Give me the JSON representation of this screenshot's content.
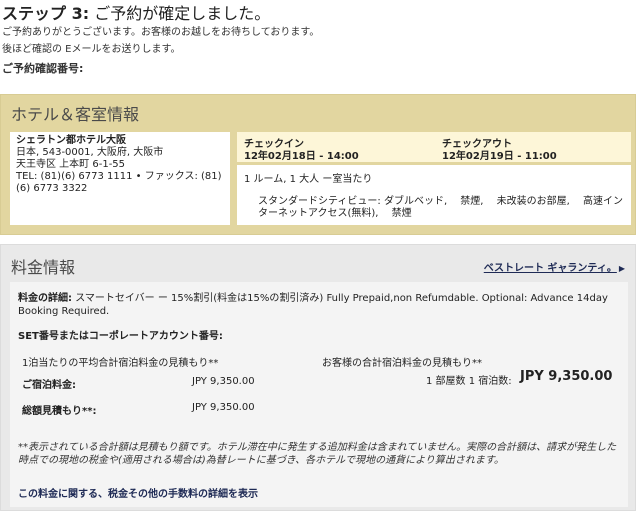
{
  "header": {
    "step_prefix": "ステップ 3:",
    "step_title": "ご予約が確定しました。",
    "intro_line1": "ご予約ありがとうございます。お客様のお越しをお待ちしております。",
    "intro_line2": "後ほど確認の Eメールをお送りします。",
    "confirmation_label": "ご予約確認番号:"
  },
  "hotel": {
    "heading": "ホテル＆客室情報",
    "name": "シェラトン都ホテル大阪",
    "address_line1": "日本, 543-0001, 大阪府, 大阪市",
    "address_line2": "天王寺区 上本町 6-1-55",
    "phone_line": "TEL: (81)(6) 6773 1111 • ファックス: (81)",
    "fax_line": "(6) 6773 3322",
    "checkin_label": "チェックイン",
    "checkin_value": "12年02月18日 - 14:00",
    "checkout_label": "チェックアウト",
    "checkout_value": "12年02月19日 - 11:00",
    "room_count": "1 ルーム, 1 大人 ー室当たり",
    "room_description": "スタンダードシティビュー: ダブルベッド,　 禁煙,　 未改装のお部屋,　 高速インターネットアクセス(無料),　 禁煙"
  },
  "rate": {
    "heading": "料金情報",
    "best_rate_link": "ベストレート ギャランティ。",
    "detail_label": "料金の詳細:",
    "detail_text": "スマートセイバー ー 15%割引(料金は15%の割引済み) Fully Prepaid,non Refumdable. Optional: Advance 14day Booking Required.",
    "set_label": "SET番号またはコーポレートアカウント番号:",
    "avg_label": "1泊当たりの平均合計宿泊料金の見積もり**",
    "total_estimate_label": "お客様の合計宿泊料金の見積もり**",
    "stay_label": "ご宿泊料金:",
    "stay_price": "JPY  9,350.00",
    "total_label": "総額見積もり**:",
    "total_price": "JPY  9,350.00",
    "counts": "1 部屋数  1 宿泊数:",
    "grand_total": "JPY 9,350.00",
    "note": "**表示されている合計額は見積もり額です。ホテル滞在中に発生する追加料金は含まれていません。実際の合計額は、請求が発生した時点での現地の税金や(適用される場合は)為替レートに基づき、各ホテルで現地の通貨により算出されます。",
    "detail_link": "この料金に関する、税金その他の手数料の詳細を表示"
  }
}
